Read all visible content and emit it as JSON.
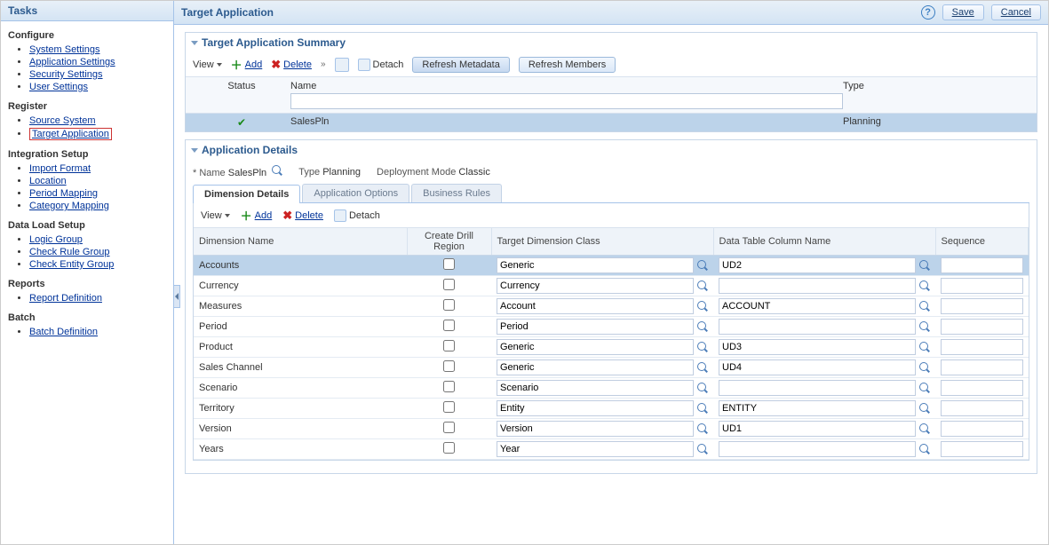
{
  "sidebar": {
    "title": "Tasks",
    "groups": [
      {
        "name": "Configure",
        "items": [
          "System Settings",
          "Application Settings",
          "Security Settings",
          "User Settings"
        ]
      },
      {
        "name": "Register",
        "items": [
          "Source System",
          "Target Application"
        ],
        "highlightIndex": 1
      },
      {
        "name": "Integration Setup",
        "items": [
          "Import Format",
          "Location",
          "Period Mapping",
          "Category Mapping"
        ]
      },
      {
        "name": "Data Load Setup",
        "items": [
          "Logic Group",
          "Check Rule Group",
          "Check Entity Group"
        ]
      },
      {
        "name": "Reports",
        "items": [
          "Report Definition"
        ]
      },
      {
        "name": "Batch",
        "items": [
          "Batch Definition"
        ]
      }
    ]
  },
  "main": {
    "title": "Target Application",
    "saveLabel": "Save",
    "cancelLabel": "Cancel"
  },
  "summary": {
    "title": "Target Application Summary",
    "viewLabel": "View",
    "addLabel": "Add",
    "deleteLabel": "Delete",
    "detachLabel": "Detach",
    "refreshMetadataLabel": "Refresh Metadata",
    "refreshMembersLabel": "Refresh Members",
    "columns": {
      "status": "Status",
      "name": "Name",
      "type": "Type"
    },
    "rows": [
      {
        "name": "SalesPln",
        "type": "Planning"
      }
    ]
  },
  "details": {
    "title": "Application Details",
    "nameLabel": "* Name",
    "nameValue": "SalesPln",
    "typeLabel": "Type",
    "typeValue": "Planning",
    "deployLabel": "Deployment Mode",
    "deployValue": "Classic",
    "tabs": [
      "Dimension Details",
      "Application Options",
      "Business Rules"
    ],
    "activeTab": 0
  },
  "dimToolbar": {
    "viewLabel": "View",
    "addLabel": "Add",
    "deleteLabel": "Delete",
    "detachLabel": "Detach"
  },
  "dimTable": {
    "headers": {
      "dimName": "Dimension Name",
      "createDrill": "Create Drill Region",
      "targetClass": "Target Dimension Class",
      "dataCol": "Data Table Column Name",
      "sequence": "Sequence"
    },
    "rows": [
      {
        "name": "Accounts",
        "drill": false,
        "target": "Generic",
        "dataCol": "UD2",
        "seq": "",
        "selected": true
      },
      {
        "name": "Currency",
        "drill": false,
        "target": "Currency",
        "dataCol": "",
        "seq": ""
      },
      {
        "name": "Measures",
        "drill": false,
        "target": "Account",
        "dataCol": "ACCOUNT",
        "seq": ""
      },
      {
        "name": "Period",
        "drill": false,
        "target": "Period",
        "dataCol": "",
        "seq": ""
      },
      {
        "name": "Product",
        "drill": false,
        "target": "Generic",
        "dataCol": "UD3",
        "seq": ""
      },
      {
        "name": "Sales Channel",
        "drill": false,
        "target": "Generic",
        "dataCol": "UD4",
        "seq": ""
      },
      {
        "name": "Scenario",
        "drill": false,
        "target": "Scenario",
        "dataCol": "",
        "seq": ""
      },
      {
        "name": "Territory",
        "drill": false,
        "target": "Entity",
        "dataCol": "ENTITY",
        "seq": ""
      },
      {
        "name": "Version",
        "drill": false,
        "target": "Version",
        "dataCol": "UD1",
        "seq": ""
      },
      {
        "name": "Years",
        "drill": false,
        "target": "Year",
        "dataCol": "",
        "seq": ""
      }
    ]
  }
}
